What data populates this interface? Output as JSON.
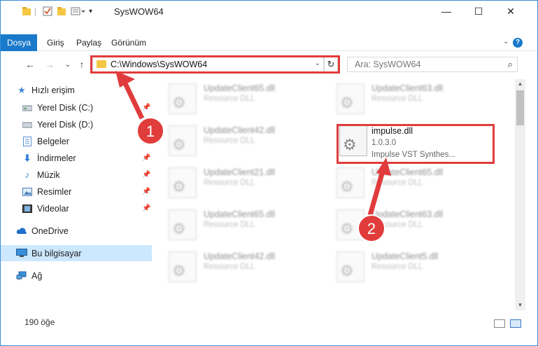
{
  "window": {
    "title": "SysWOW64",
    "controls": {
      "minimize": "—",
      "maximize": "☐",
      "close": "✕"
    }
  },
  "ribbon": {
    "tabs": [
      "Dosya",
      "Giriş",
      "Paylaş",
      "Görünüm"
    ],
    "help": "?"
  },
  "address": {
    "path": "C:\\Windows\\SysWOW64",
    "search_placeholder": "Ara: SysWOW64"
  },
  "sidebar": {
    "items": [
      {
        "label": "Hızlı erişim",
        "icon": "star-icon",
        "pinned": false
      },
      {
        "label": "Yerel Disk (C:)",
        "icon": "drive-icon",
        "pinned": true
      },
      {
        "label": "Yerel Disk (D:)",
        "icon": "drive-icon",
        "pinned": false
      },
      {
        "label": "Belgeler",
        "icon": "documents-icon",
        "pinned": true
      },
      {
        "label": "İndirmeler",
        "icon": "download-icon",
        "pinned": true
      },
      {
        "label": "Müzik",
        "icon": "music-icon",
        "pinned": true
      },
      {
        "label": "Resimler",
        "icon": "pictures-icon",
        "pinned": true
      },
      {
        "label": "Videolar",
        "icon": "video-icon",
        "pinned": true
      },
      {
        "label": "OneDrive",
        "icon": "cloud-icon",
        "pinned": false
      },
      {
        "label": "Bu bilgisayar",
        "icon": "computer-icon",
        "pinned": false,
        "selected": true
      },
      {
        "label": "Ağ",
        "icon": "network-icon",
        "pinned": false
      }
    ]
  },
  "files": [
    {
      "name": "UpdateClient65.dll",
      "type": "Resource DLL"
    },
    {
      "name": "UpdateClient63.dll",
      "type": "Resource DLL"
    },
    {
      "name": "UpdateClient42.dll",
      "type": "Resource DLL"
    },
    {
      "name": "impulse.dll",
      "version": "1.0.3.0",
      "description": "Impulse VST Synthes..."
    },
    {
      "name": "UpdateClient21.dll",
      "type": "Resource DLL"
    },
    {
      "name": "UpdateClient65.dll",
      "type": "Resource DLL"
    },
    {
      "name": "UpdateClient65.dll",
      "type": "Resource DLL"
    },
    {
      "name": "UpdateClient63.dll",
      "type": "Resource DLL"
    },
    {
      "name": "UpdateClient42.dll",
      "type": "Resource DLL"
    },
    {
      "name": "UpdateClient5.dll",
      "type": "Resource DLL"
    }
  ],
  "status": {
    "count": "190 öğe"
  },
  "annotations": {
    "step1": "1",
    "step2": "2",
    "color": "#e03c3c"
  }
}
